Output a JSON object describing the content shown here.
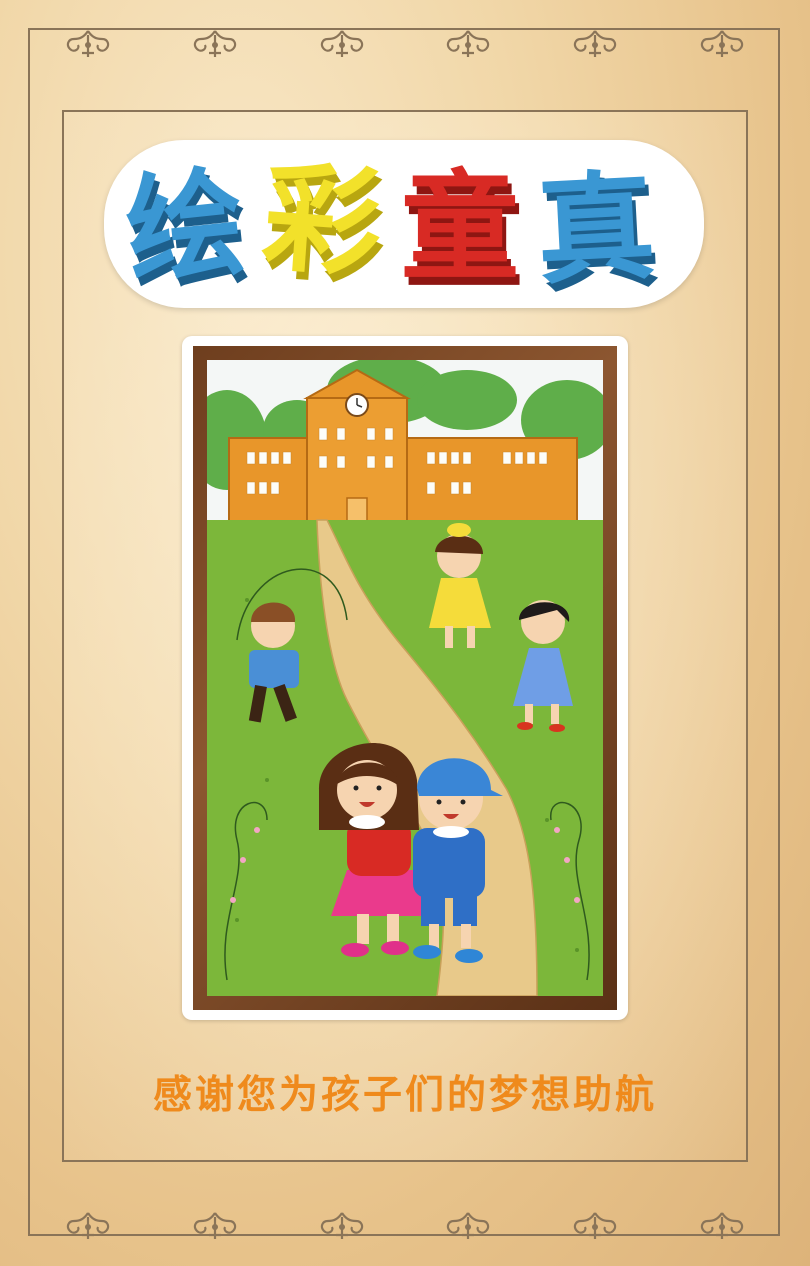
{
  "title": {
    "chars": [
      {
        "text": "绘",
        "color": "#3a97d3"
      },
      {
        "text": "彩",
        "color": "#f2e12a"
      },
      {
        "text": "童",
        "color": "#d82a24"
      },
      {
        "text": "真",
        "color": "#3a97d3"
      }
    ]
  },
  "caption": "感谢您为孩子们的梦想助航",
  "colors": {
    "caption": "#ef8a1c",
    "frame_wood": "#7a4522",
    "border_line": "#8a7458",
    "grass": "#7cb73a",
    "school": "#e8962a",
    "path": "#e8c98a"
  },
  "icons": [
    "ornament-icon",
    "clock-icon"
  ],
  "illustration": {
    "subject": "school-scene",
    "figures": [
      "boy-jumping-rope",
      "girl-yellow-dress",
      "girl-blue-dress",
      "girl-red-sweater",
      "boy-blue-cap"
    ]
  }
}
